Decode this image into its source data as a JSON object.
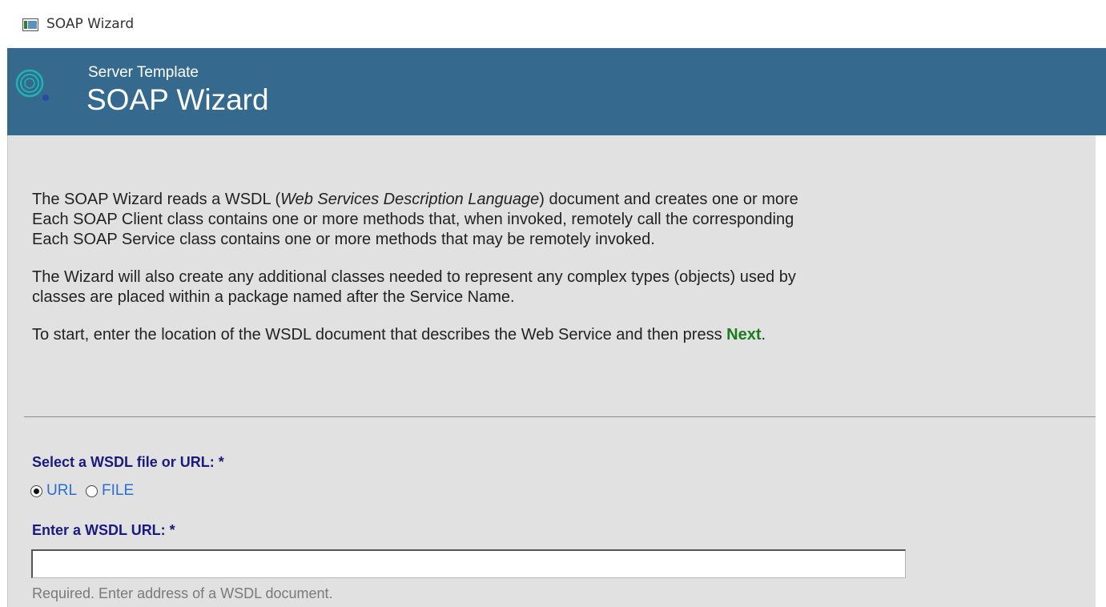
{
  "window": {
    "title": "SOAP Wizard"
  },
  "header": {
    "subtitle": "Server Template",
    "title": "SOAP Wizard",
    "background_color": "#356a8e"
  },
  "intro": {
    "p1_before": "The SOAP Wizard reads a WSDL (",
    "p1_em": "Web Services Description Language",
    "p1_after": ") document and creates one or more",
    "p1_line2": "Each SOAP Client class contains one or more methods that, when invoked, remotely call the corresponding",
    "p1_line3": "Each SOAP Service class contains one or more methods that may be remotely invoked.",
    "p2_line1": "The Wizard will also create any additional classes needed to represent any complex types (objects) used by",
    "p2_line2": "classes are placed within a package named after the Service Name.",
    "p3_before": "To start, enter the location of the WSDL document that describes the Web Service and then press ",
    "p3_next": "Next",
    "p3_after": "."
  },
  "form": {
    "select_label": "Select a WSDL file or URL: *",
    "source_options": [
      {
        "label": "URL",
        "checked": true
      },
      {
        "label": "FILE",
        "checked": false
      }
    ],
    "url_label": "Enter a WSDL URL: *",
    "url_value": "",
    "url_hint": "Required. Enter address of a WSDL document."
  },
  "colors": {
    "label": "#1a1a80",
    "radio_text": "#2a6fcf",
    "next_highlight": "#1c7d1c",
    "hint": "#7a7a7a"
  }
}
